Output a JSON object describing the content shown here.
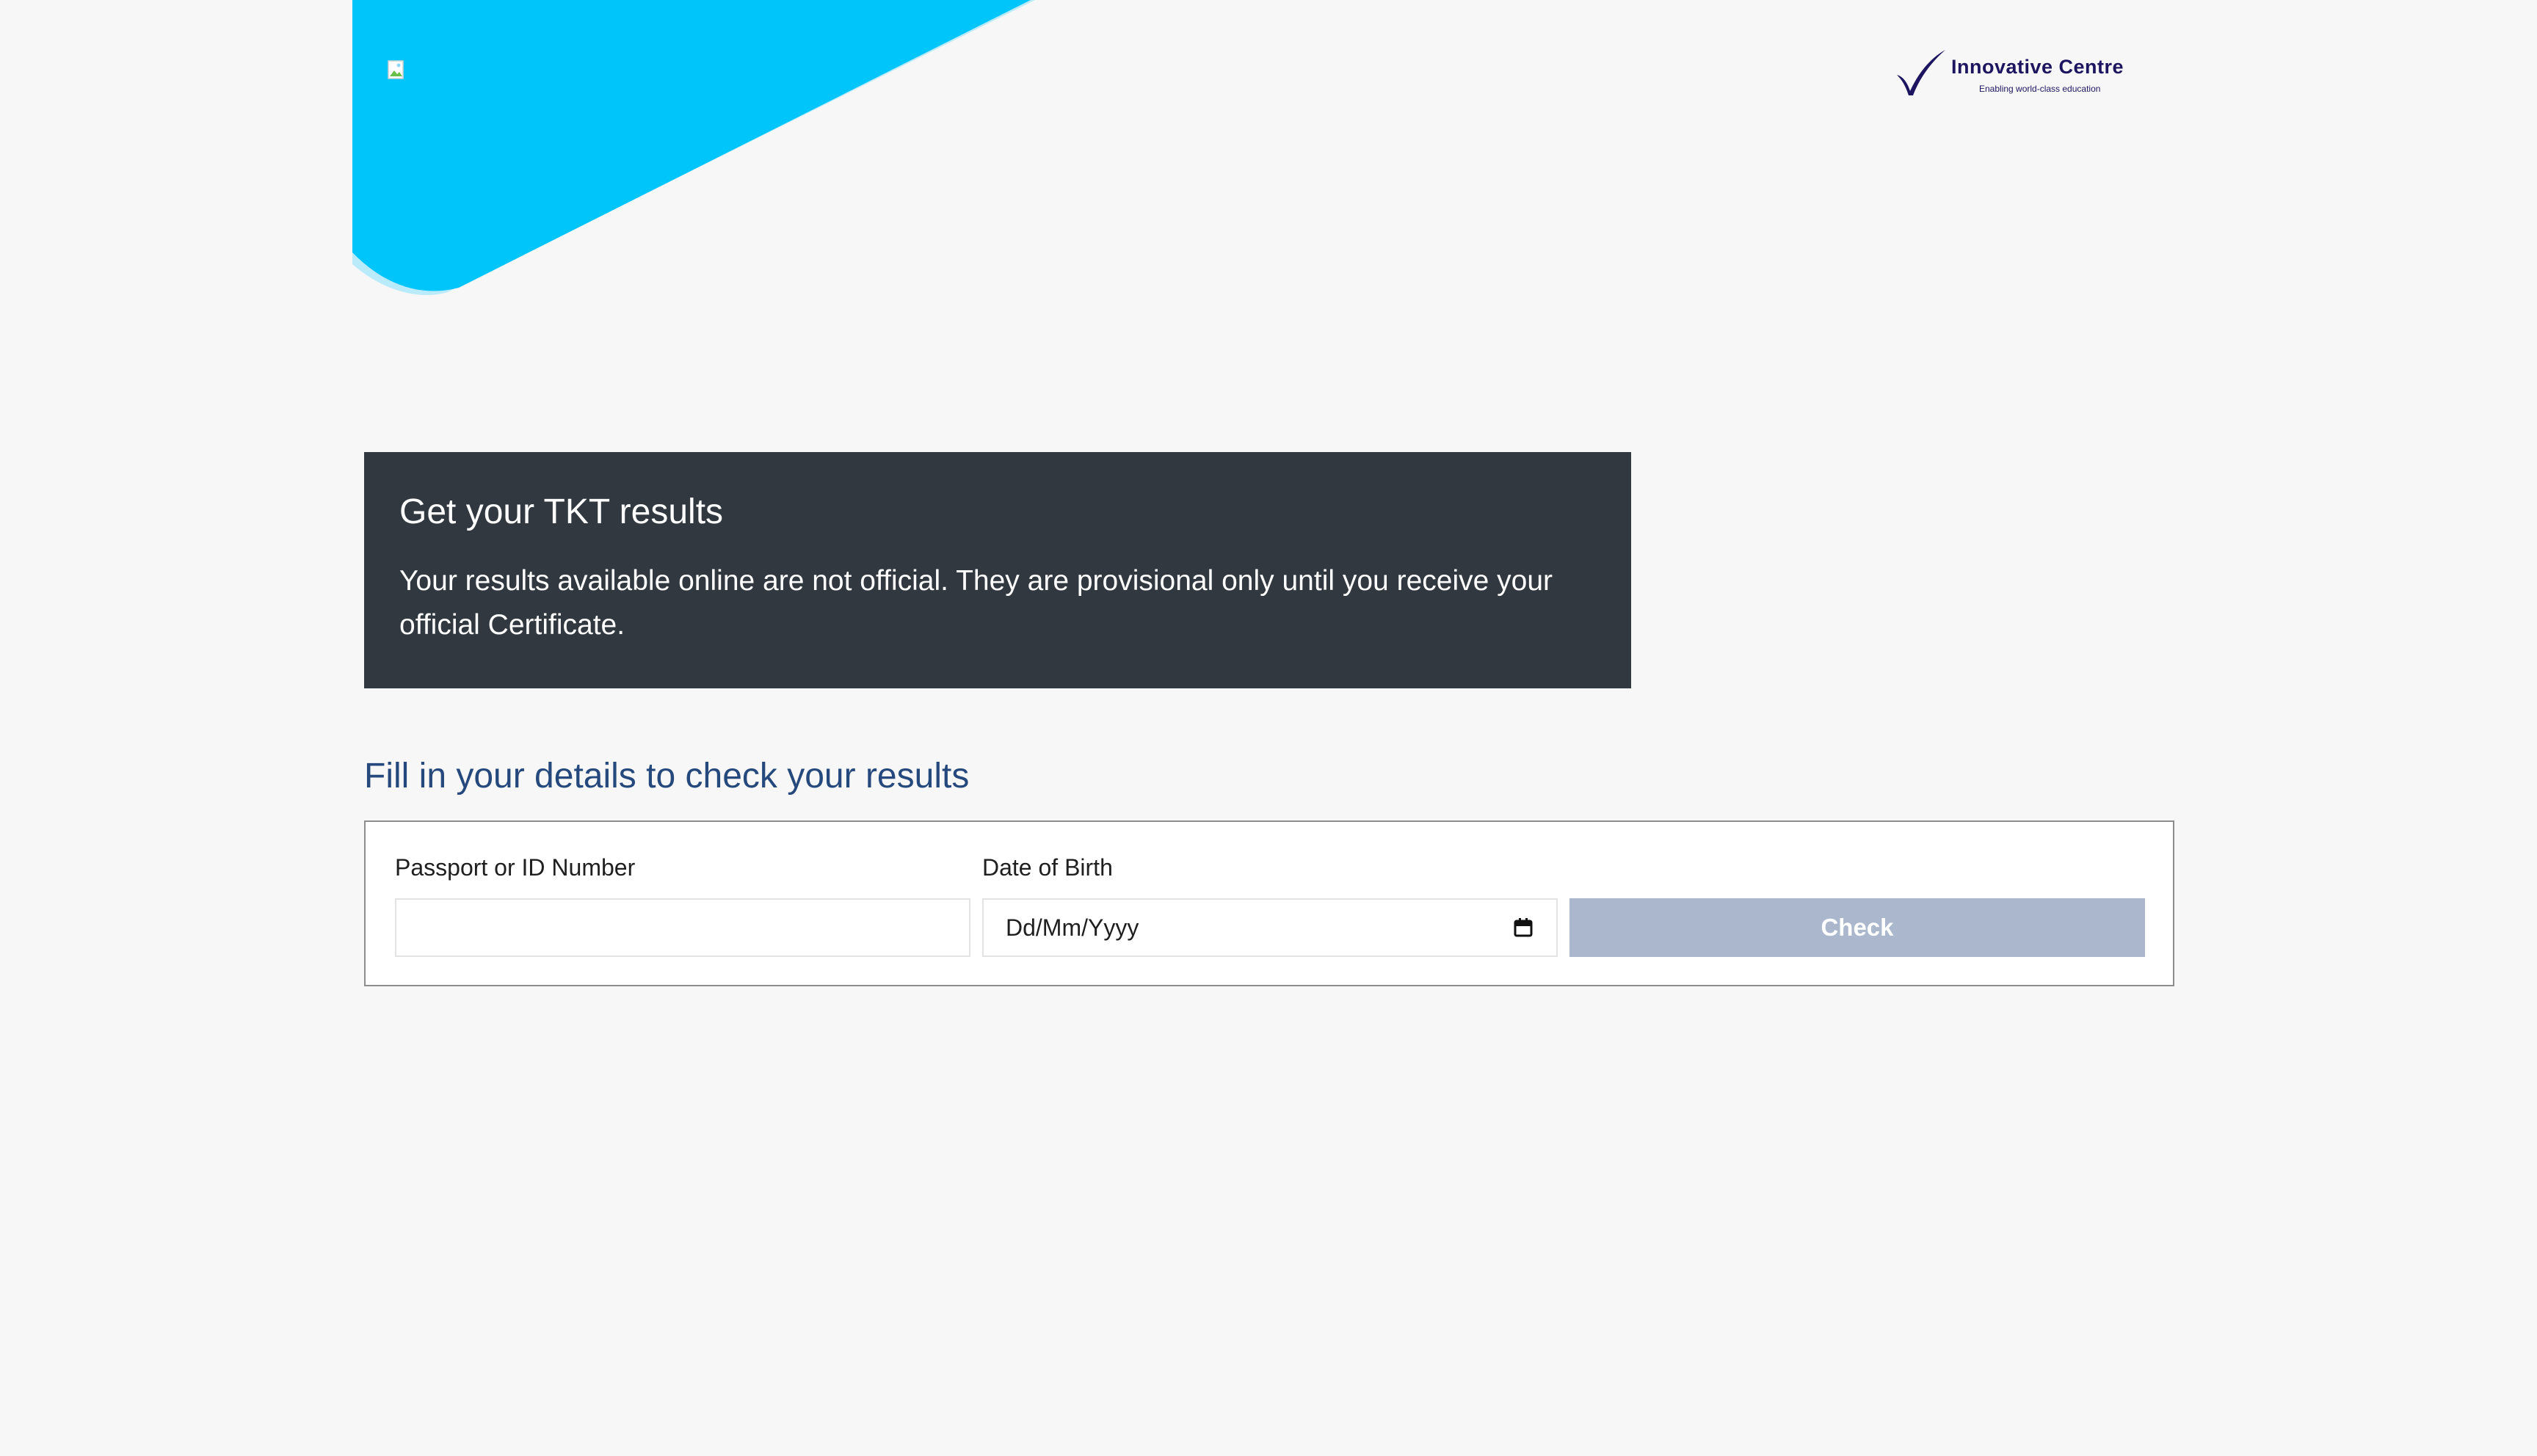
{
  "header": {
    "banner_color": "#00c5fb",
    "banner_shadow_color": "#b9ebfb"
  },
  "brand": {
    "name": "Innovative Centre",
    "tagline": "Enabling world-class education",
    "color": "#1d1560"
  },
  "notice": {
    "title": "Get your TKT results",
    "body": "Your results available online are not official. They are provisional only until you receive your official Certificate.",
    "background": "#32383f"
  },
  "form": {
    "heading": "Fill in your details to check your results",
    "heading_color": "#25497c",
    "passport_label": "Passport or ID Number",
    "passport_value": "",
    "dob_label": "Date of Birth",
    "dob_placeholder": "Dd/Mm/Yyyy",
    "check_label": "Check",
    "check_color": "#aab7cd",
    "icons": {
      "date_picker": "calendar-icon",
      "logo_placeholder": "broken-image-icon",
      "brand_mark": "checkmark-logo-icon"
    }
  }
}
